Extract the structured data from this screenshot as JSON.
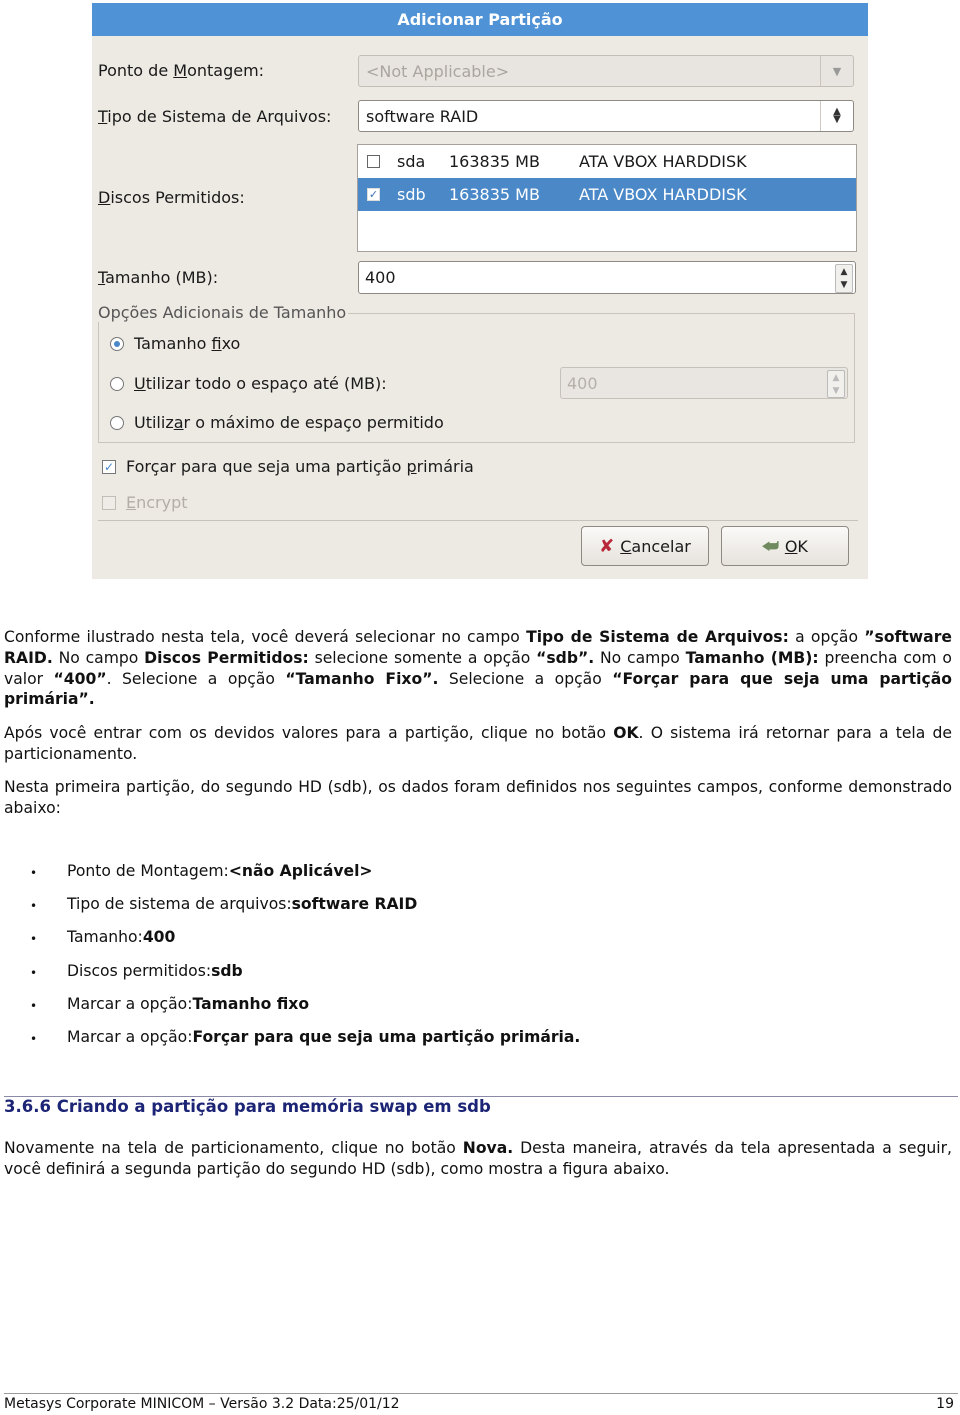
{
  "dialog": {
    "title": "Adicionar Partição",
    "mount_point": {
      "label_pre": "Ponto de ",
      "label_u": "M",
      "label_post": "ontagem:",
      "value": "<Not Applicable>"
    },
    "fs_type": {
      "label_u": "T",
      "label_post": "ipo de Sistema de Arquivos:",
      "value": "software RAID"
    },
    "disks": {
      "label_u": "D",
      "label_post": "iscos Permitidos:",
      "rows": [
        {
          "device": "sda",
          "size": "163835 MB",
          "model": "ATA VBOX HARDDISK",
          "checked": false,
          "check_glyph": ""
        },
        {
          "device": "sdb",
          "size": "163835 MB",
          "model": "ATA VBOX HARDDISK",
          "checked": true,
          "check_glyph": "✓"
        }
      ]
    },
    "size": {
      "label_u": "T",
      "label_post": "amanho (MB):",
      "value": "400"
    },
    "size_options": {
      "legend": "Opções Adicionais de Tamanho",
      "fixed": {
        "pre": "Tamanho ",
        "u": "f",
        "post": "ixo",
        "selected": true
      },
      "fill_upto": {
        "pre": "",
        "u": "U",
        "post": "tilizar todo o espaço até (MB):",
        "selected": false,
        "value": "400"
      },
      "fill_max": {
        "pre": "Utiliz",
        "u": "a",
        "post": "r o máximo de espaço permitido",
        "selected": false
      }
    },
    "force_primary": {
      "pre": "Forçar para que seja uma partição ",
      "u": "p",
      "post": "rimária",
      "checked": true,
      "check_glyph": "✓"
    },
    "encrypt": {
      "u": "E",
      "post": "ncrypt",
      "checked": false,
      "disabled": true
    },
    "buttons": {
      "cancel": {
        "u": "C",
        "post": "ancelar",
        "icon": "✘"
      },
      "ok": {
        "u": "O",
        "post": "K",
        "icon": "⮨"
      }
    }
  },
  "document": {
    "paragraph1": [
      {
        "t": "Conforme ilustrado nesta tela, você deverá selecionar no campo ",
        "b": false
      },
      {
        "t": "Tipo de Sistema de Arquivos:",
        "b": true
      },
      {
        "t": " a opção ",
        "b": false
      },
      {
        "t": "”software RAID.",
        "b": true
      },
      {
        "t": " No campo ",
        "b": false
      },
      {
        "t": "Discos Permitidos:",
        "b": true
      },
      {
        "t": " selecione somente a opção ",
        "b": false
      },
      {
        "t": "“sdb”.",
        "b": true
      },
      {
        "t": " No campo ",
        "b": false
      },
      {
        "t": "Tamanho (MB):",
        "b": true
      },
      {
        "t": " preencha com o valor ",
        "b": false
      },
      {
        "t": "“400”",
        "b": true
      },
      {
        "t": ". Selecione a opção ",
        "b": false
      },
      {
        "t": "“Tamanho Fixo”.",
        "b": true
      },
      {
        "t": " Selecione a opção ",
        "b": false
      },
      {
        "t": "“Forçar para que seja uma partição primária”.",
        "b": true
      }
    ],
    "paragraph2": [
      {
        "t": "Após você entrar com os devidos valores para a partição, clique no botão ",
        "b": false
      },
      {
        "t": "OK",
        "b": true
      },
      {
        "t": ". O sistema irá retornar para a tela de particionamento.",
        "b": false
      }
    ],
    "paragraph3": "Nesta primeira partição, do segundo HD (sdb), os dados foram definidos nos seguintes campos, conforme demonstrado abaixo:",
    "bullet_glyph": "•",
    "bullets": [
      {
        "label": "Ponto de Montagem: ",
        "value": "<não Aplicável>"
      },
      {
        "label": "Tipo de sistema de arquivos: ",
        "value": "software RAID"
      },
      {
        "label": "Tamanho: ",
        "value": "400"
      },
      {
        "label": "Discos permitidos: ",
        "value": "sdb"
      },
      {
        "label": "Marcar a opção: ",
        "value": "Tamanho fixo"
      },
      {
        "label": "Marcar a opção: ",
        "value": "Forçar para que seja uma partição primária."
      }
    ],
    "section_title": "3.6.6 Criando a partição para memória swap em sdb",
    "paragraph4": [
      {
        "t": "Novamente na tela de particionamento, clique no botão ",
        "b": false
      },
      {
        "t": "Nova.",
        "b": true
      },
      {
        "t": " Desta maneira, através da tela apresentada a seguir, você definirá a segunda partição do segundo HD (sdb), como mostra a figura abaixo.",
        "b": false
      }
    ]
  },
  "footer": {
    "left": "Metasys Corporate MINICOM – Versão 3.2 Data:25/01/12",
    "page_number": "19"
  },
  "colors": {
    "dialog_title_bar": "#4f93d6",
    "selection": "#4a88c8",
    "section_title": "#1c2475",
    "cancel_icon": "#b8283a"
  }
}
